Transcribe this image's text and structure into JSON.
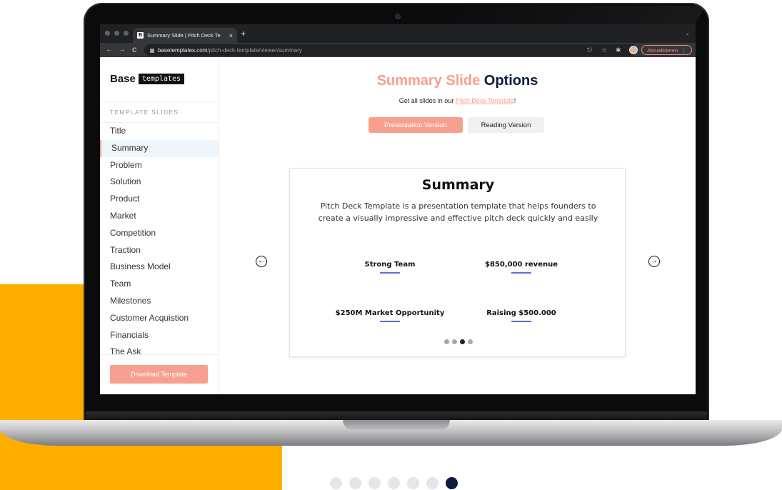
{
  "browser": {
    "tab_title": "Summary Slide | Pitch Deck Te",
    "tab_favicon": "B",
    "new_tab": "+",
    "tab_close": "×",
    "url_host": "basetemplates.com",
    "url_path": "/pitch-deck-template/viewer/summary",
    "update_label": "Aktualisieren",
    "nav_back": "←",
    "nav_forward": "→",
    "nav_reload": "C",
    "icons": [
      "share-icon",
      "star-icon",
      "extensions-icon",
      "profile-avatar-icon",
      "more-icon"
    ]
  },
  "sidebar": {
    "brand_base": "Base",
    "brand_tag": "templates",
    "heading": "TEMPLATE SLIDES",
    "items": [
      {
        "label": "Title"
      },
      {
        "label": "Summary",
        "active": true
      },
      {
        "label": "Problem"
      },
      {
        "label": "Solution"
      },
      {
        "label": "Product"
      },
      {
        "label": "Market"
      },
      {
        "label": "Competition"
      },
      {
        "label": "Traction"
      },
      {
        "label": "Business Model"
      },
      {
        "label": "Team"
      },
      {
        "label": "Milestones"
      },
      {
        "label": "Customer Acquistion"
      },
      {
        "label": "Financials"
      },
      {
        "label": "The Ask"
      }
    ],
    "download_label": "Download Template"
  },
  "main": {
    "headline_accent": "Summary Slide",
    "headline_dark": "Options",
    "subline_prefix": "Get all slides in our ",
    "subline_link": "Pitch Deck Template",
    "subline_suffix": "!",
    "toggle": {
      "presentation": "Presentation Version",
      "reading": "Reading Version",
      "selected": "presentation"
    }
  },
  "slide": {
    "title": "Summary",
    "description": "Pitch Deck Template is a presentation template that helps founders to create a visually impressive and effective pitch deck quickly and easily",
    "kpis": [
      {
        "label": "Strong Team"
      },
      {
        "label": "$850,000 revenue"
      },
      {
        "label": "$250M Market Opportunity"
      },
      {
        "label": "Raising $500.000"
      }
    ],
    "dots_total": 4,
    "dots_active_index": 2
  },
  "outer_pager": {
    "total": 7,
    "active_index": 6
  },
  "colors": {
    "accent": "#F7A08F",
    "navy": "#0d1b3e",
    "orange_block": "#FFAE00",
    "kpi_underline": "#5b6fd6"
  }
}
